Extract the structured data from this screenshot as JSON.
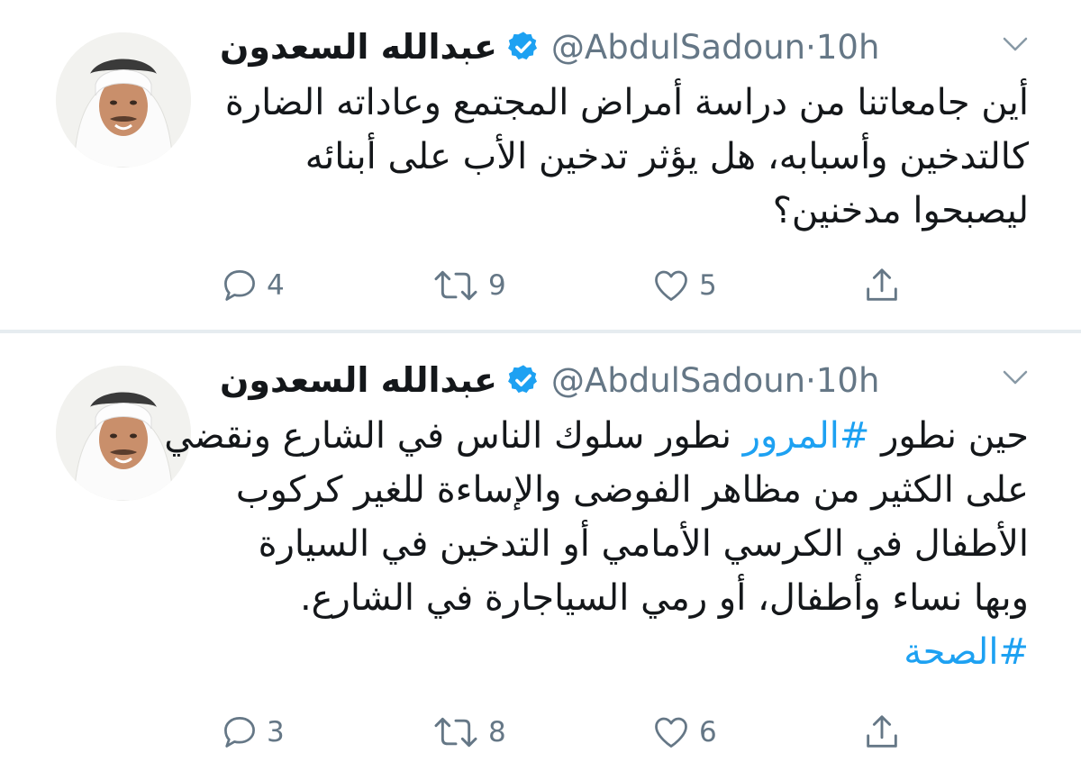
{
  "tweets": [
    {
      "author_name": "عبدالله السعدون",
      "handle": "@AbdulSadoun",
      "separator": "·",
      "time": "10h",
      "lines": [
        [
          {
            "text": "أين جامعاتنا من دراسة أمراض المجتمع وعاداته الضارة",
            "hashtag": false
          }
        ],
        [
          {
            "text": "كالتدخين وأسبابه، هل يؤثر تدخين الأب على أبنائه",
            "hashtag": false
          }
        ],
        [
          {
            "text": "ليصبحوا مدخنين؟",
            "hashtag": false
          }
        ]
      ],
      "reply_count": "4",
      "retweet_count": "9",
      "like_count": "5"
    },
    {
      "author_name": "عبدالله السعدون",
      "handle": "@AbdulSadoun",
      "separator": "·",
      "time": "10h",
      "lines": [
        [
          {
            "text": "حين نطور ",
            "hashtag": false
          },
          {
            "text": "#المرور",
            "hashtag": true
          },
          {
            "text": " نطور سلوك الناس في الشارع ونقضي",
            "hashtag": false
          }
        ],
        [
          {
            "text": "على الكثير من مظاهر الفوضى والإساءة للغير كركوب",
            "hashtag": false
          }
        ],
        [
          {
            "text": "الأطفال في الكرسي الأمامي أو التدخين في السيارة",
            "hashtag": false
          }
        ],
        [
          {
            "text": "وبها نساء وأطفال، أو رمي السياجارة في الشارع.",
            "hashtag": false
          }
        ],
        [
          {
            "text": "#الصحة",
            "hashtag": true
          }
        ]
      ],
      "reply_count": "3",
      "retweet_count": "8",
      "like_count": "6"
    }
  ],
  "icons": {
    "verified": "verified-badge-icon",
    "caret": "chevron-down-icon",
    "reply": "reply-icon",
    "retweet": "retweet-icon",
    "like": "heart-icon",
    "share": "share-icon"
  },
  "colors": {
    "text": "#14171a",
    "secondary": "#657786",
    "link": "#1da1f2",
    "divider": "#e6ecf0"
  }
}
